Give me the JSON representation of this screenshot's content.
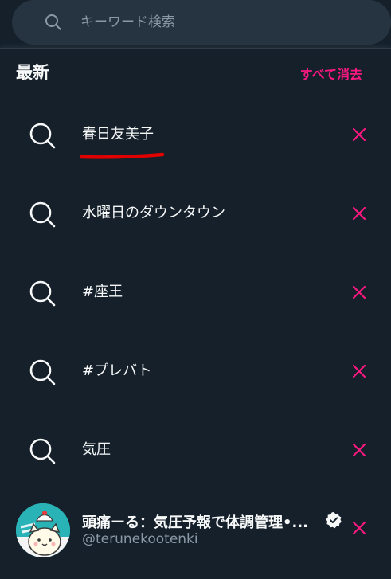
{
  "search": {
    "placeholder": "キーワード検索",
    "icon": "search-icon"
  },
  "panel": {
    "title": "最新",
    "clear_all_label": "すべて消去"
  },
  "recent": [
    {
      "label": "春日友美子",
      "icon": "search-icon",
      "remove_icon": "close-icon"
    },
    {
      "label": "水曜日のダウンタウン",
      "icon": "search-icon",
      "remove_icon": "close-icon"
    },
    {
      "label": "#座王",
      "icon": "search-icon",
      "remove_icon": "close-icon"
    },
    {
      "label": "#プレバト",
      "icon": "search-icon",
      "remove_icon": "close-icon"
    },
    {
      "label": "気圧",
      "icon": "search-icon",
      "remove_icon": "close-icon"
    }
  ],
  "account": {
    "name": "頭痛ーる：気圧予報で体調管理•...",
    "handle": "@terunekootenki",
    "verified_icon": "verified-badge-icon",
    "remove_icon": "close-icon"
  },
  "colors": {
    "background": "#15202b",
    "search_bg": "#263441",
    "accent": "#f91880",
    "text_primary": "#f7f9f9",
    "text_secondary": "#8b98a5",
    "annotation_underline": "#e00000"
  }
}
